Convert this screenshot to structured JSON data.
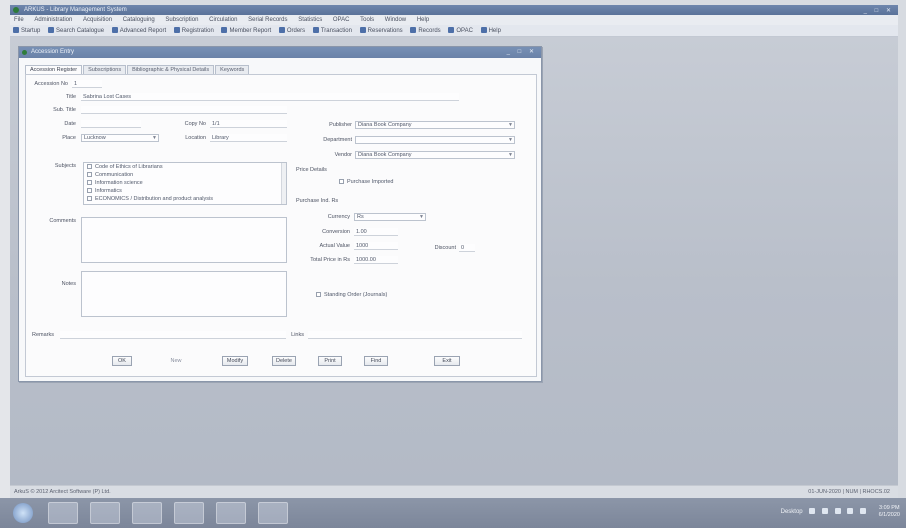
{
  "window": {
    "title": "ARKUS - Library Management System",
    "controls": "_ □ ✕"
  },
  "menu": [
    "File",
    "Administration",
    "Acquisition",
    "Cataloguing",
    "Subscription",
    "Circulation",
    "Serial Records",
    "Statistics",
    "OPAC",
    "Tools",
    "Window",
    "Help"
  ],
  "toolbar": [
    {
      "label": "Startup",
      "icon": "startup-icon"
    },
    {
      "label": "Search Catalogue",
      "icon": "catalogue-icon"
    },
    {
      "label": "Advanced Report",
      "icon": "report-icon"
    },
    {
      "label": "Registration",
      "icon": "registration-icon"
    },
    {
      "label": "Member Report",
      "icon": "member-icon"
    },
    {
      "label": "Orders",
      "icon": "orders-icon"
    },
    {
      "label": "Transaction",
      "icon": "transaction-icon"
    },
    {
      "label": "Reservations",
      "icon": "reservation-icon"
    },
    {
      "label": "Records",
      "icon": "records-icon"
    },
    {
      "label": "OPAC",
      "icon": "opac-icon"
    },
    {
      "label": "Help",
      "icon": "help-icon"
    }
  ],
  "form": {
    "title": "Accession Entry",
    "controls": "_ □ ✕",
    "tabs": [
      "Accession Register",
      "Subscriptions",
      "Bibliographic & Physical Details",
      "Keywords"
    ],
    "labels": {
      "accession_no": "Accession No",
      "title": "Title",
      "sub_title": "Sub. Title",
      "date": "Date",
      "copy_no": "Copy No",
      "place": "Place",
      "location": "Location",
      "subjects": "Subjects",
      "comments": "Comments",
      "notes": "Notes",
      "remarks": "Remarks",
      "links": "Links",
      "publisher": "Publisher",
      "department": "Department",
      "vendor": "Vendor",
      "price_details": "Price Details",
      "purchase_ind_rs": "Purchase Ind. Rs",
      "currency": "Currency",
      "conversion": "Conversion",
      "actual_value": "Actual Value",
      "total_price": "Total Price in Rs",
      "discount": "Discount"
    },
    "values": {
      "accession_no": "1",
      "title": "Sabrina Lost Cases",
      "copy_no": "1/1",
      "place": "Lucknow",
      "location": "Library",
      "publisher": "Diana Book Company",
      "department": "",
      "vendor": "Diana Book Company",
      "currency": "Rs",
      "conversion": "1.00",
      "actual_value": "1000",
      "total_price": "1000.00",
      "discount": "0"
    },
    "subjects": [
      "Code of Ethics of Librarians",
      "Communication",
      "Information science",
      "Informatics",
      "ECONOMICS / Distribution and product analysis"
    ],
    "checks": {
      "foreign_currency": "Purchase Imported",
      "standing_order": "Standing Order (Journals)"
    },
    "buttons": {
      "ok": "OK",
      "new": "New",
      "modify": "Modify",
      "delete": "Delete",
      "print": "Print",
      "find": "Find",
      "exit": "Exit"
    }
  },
  "status": {
    "left": "ArkuS © 2012 Arcitect Software (P) Ltd.",
    "right": "01-JUN-2020 | NUM | RHOCS.02"
  },
  "tray": {
    "label": "Desktop",
    "time": "3:09 PM",
    "date": "6/1/2020"
  }
}
